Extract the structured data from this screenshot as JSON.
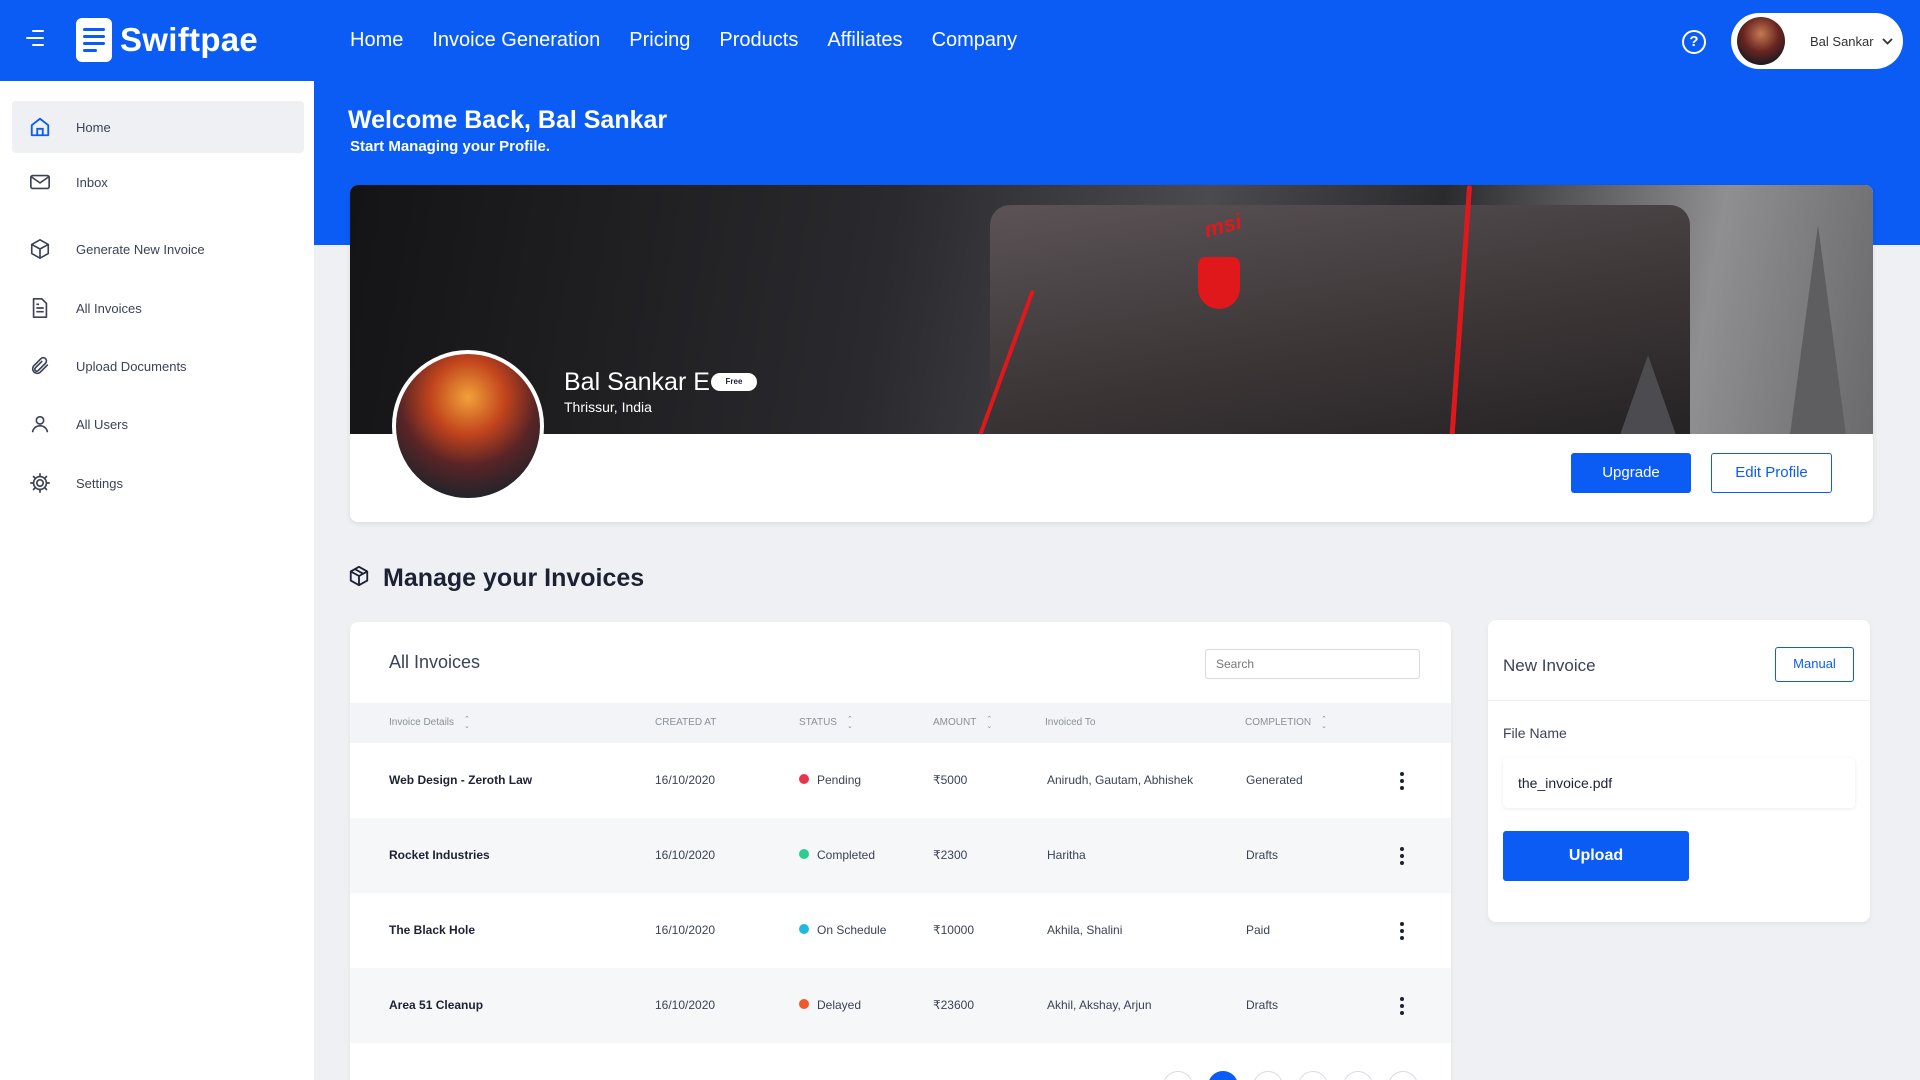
{
  "app": {
    "name": "Swiftpae",
    "brand_color": "#0a5cf5"
  },
  "nav": {
    "items": [
      "Home",
      "Invoice Generation",
      "Pricing",
      "Products",
      "Affiliates",
      "Company"
    ]
  },
  "user_menu": {
    "name": "Bal Sankar",
    "icon": "chevron-down-icon"
  },
  "sidebar": {
    "items": [
      {
        "label": "Home",
        "icon": "home-icon",
        "active": true
      },
      {
        "label": "Inbox",
        "icon": "mail-icon"
      },
      {
        "label": "Generate New Invoice",
        "icon": "box-icon"
      },
      {
        "label": "All Invoices",
        "icon": "document-icon"
      },
      {
        "label": "Upload Documents",
        "icon": "paperclip-icon"
      },
      {
        "label": "All Users",
        "icon": "user-icon"
      },
      {
        "label": "Settings",
        "icon": "gear-icon"
      }
    ]
  },
  "header": {
    "welcome": "Welcome Back, Bal Sankar",
    "subtitle": "Start Managing your Profile."
  },
  "profile": {
    "name": "Bal Sankar E",
    "badge": "Free",
    "location": "Thrissur, India",
    "cover_text": "msi",
    "upgrade_label": "Upgrade",
    "edit_label": "Edit Profile"
  },
  "manage": {
    "title": "Manage your Invoices"
  },
  "invoices": {
    "title": "All Invoices",
    "search_placeholder": "Search",
    "columns": [
      "Invoice Details",
      "CREATED AT",
      "STATUS",
      "AMOUNT",
      "Invoiced To",
      "COMPLETION"
    ],
    "rows": [
      {
        "name": "Web Design - Zeroth Law",
        "created": "16/10/2020",
        "status": "Pending",
        "status_color": "#e8344e",
        "amount": "₹5000",
        "invoiced_to": "Anirudh, Gautam, Abhishek",
        "completion": "Generated"
      },
      {
        "name": "Rocket Industries",
        "created": "16/10/2020",
        "status": "Completed",
        "status_color": "#2dcc8f",
        "amount": "₹2300",
        "invoiced_to": "Haritha",
        "completion": "Drafts"
      },
      {
        "name": "The Black Hole",
        "created": "16/10/2020",
        "status": "On Schedule",
        "status_color": "#20b8e0",
        "amount": "₹10000",
        "invoiced_to": "Akhila, Shalini",
        "completion": "Paid"
      },
      {
        "name": "Area 51 Cleanup",
        "created": "16/10/2020",
        "status": "Delayed",
        "status_color": "#f0592a",
        "amount": "₹23600",
        "invoiced_to": "Akhil, Akshay, Arjun",
        "completion": "Drafts"
      }
    ]
  },
  "new_invoice": {
    "title": "New Invoice",
    "manual_label": "Manual",
    "file_name_label": "File Name",
    "file_name_value": "the_invoice.pdf",
    "upload_label": "Upload"
  }
}
